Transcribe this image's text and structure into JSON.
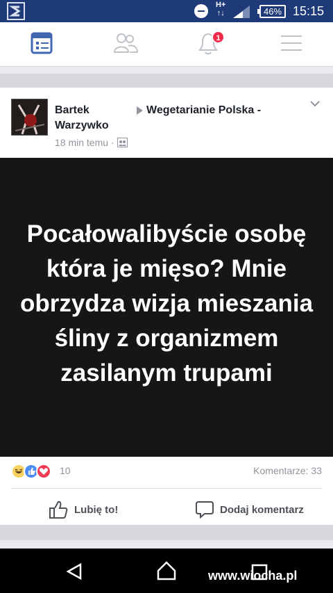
{
  "status": {
    "carrier_icon": "s-app-icon",
    "network": "H+",
    "battery": "46%",
    "time": "15:15"
  },
  "nav": {
    "items": [
      {
        "icon": "news-feed-icon",
        "active": true
      },
      {
        "icon": "friends-icon",
        "active": false
      },
      {
        "icon": "notifications-icon",
        "active": false,
        "badge": "1"
      },
      {
        "icon": "menu-icon",
        "active": false
      }
    ]
  },
  "post": {
    "author_first": "Bartek",
    "author_last": "Warzywko",
    "group": "Wegetarianie Polska -",
    "time": "18 min temu",
    "image_text": "Pocałowalibyście osobę która je mięso? Mnie obrzydza wizja mieszania śliny z organizmem zasilanym trupami",
    "reactions_count": "10",
    "comments": "Komentarze: 33",
    "like_label": "Lubię to!",
    "comment_label": "Dodaj komentarz"
  },
  "watermark": "www.wiocha.pl",
  "colors": {
    "status_bar": "#1f3a78",
    "active_nav": "#4267b2",
    "badge": "#f02849"
  }
}
